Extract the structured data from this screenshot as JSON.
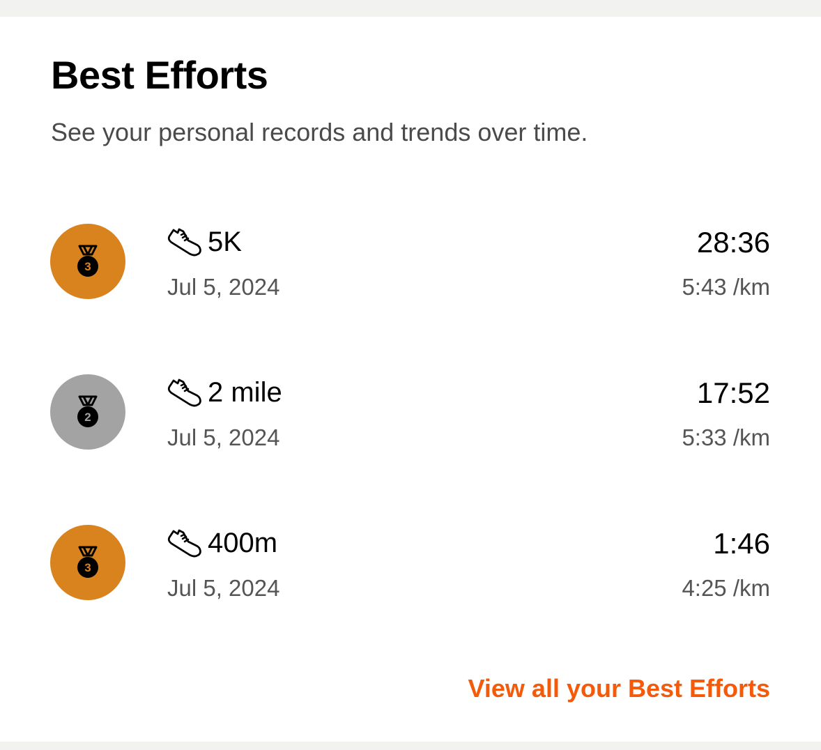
{
  "header": {
    "title": "Best Efforts",
    "subtitle": "See your personal records and trends over time."
  },
  "colors": {
    "bronze": "#d9831f",
    "silver": "#a3a3a3",
    "accent": "#f45a0a"
  },
  "efforts": [
    {
      "rank": "3",
      "medal": "bronze-medal-icon",
      "icon": "running-shoe-icon",
      "name": "5K",
      "date": "Jul 5, 2024",
      "time": "28:36",
      "pace": "5:43 /km"
    },
    {
      "rank": "2",
      "medal": "silver-medal-icon",
      "icon": "running-shoe-icon",
      "name": "2 mile",
      "date": "Jul 5, 2024",
      "time": "17:52",
      "pace": "5:33 /km"
    },
    {
      "rank": "3",
      "medal": "bronze-medal-icon",
      "icon": "running-shoe-icon",
      "name": "400m",
      "date": "Jul 5, 2024",
      "time": "1:46",
      "pace": "4:25 /km"
    }
  ],
  "footer": {
    "view_all_label": "View all your Best Efforts"
  }
}
